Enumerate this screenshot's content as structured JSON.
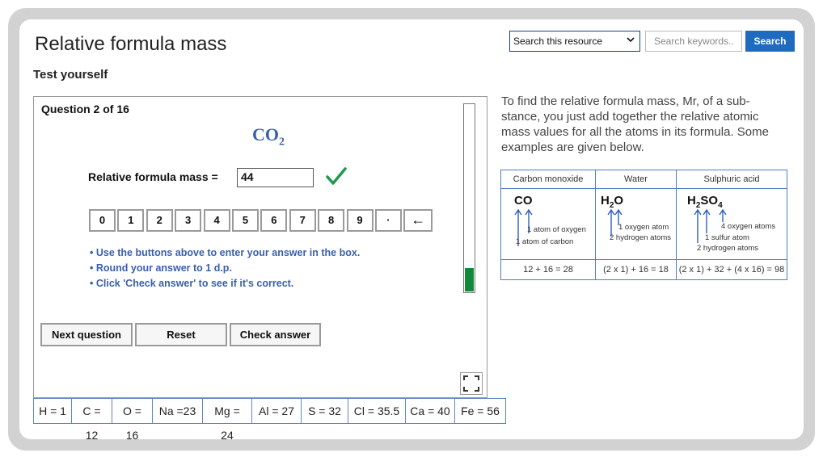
{
  "header": {
    "title": "Relative formula mass",
    "subtitle": "Test yourself",
    "search_select_value": "Search this resource",
    "search_placeholder": "Search keywords..",
    "search_button": "Search"
  },
  "quiz": {
    "question_count": "Question 2 of 16",
    "formula_main": "CO",
    "formula_sub": "2",
    "rfm_label": "Relative formula mass =",
    "answer_value": "44",
    "answer_status": "correct",
    "keypad": [
      "0",
      "1",
      "2",
      "3",
      "4",
      "5",
      "6",
      "7",
      "8",
      "9",
      "·",
      "←"
    ],
    "instructions": [
      "• Use the buttons above to enter your answer in the box.",
      "• Round your answer to 1 d.p.",
      "• Click 'Check answer' to see if it's correct."
    ],
    "progress_fraction": 0.125,
    "buttons": {
      "next": "Next question",
      "reset": "Reset",
      "check": "Check answer"
    }
  },
  "atomic_masses": [
    "H = 1",
    "C = 12",
    "O = 16",
    "Na =23",
    "Mg = 24",
    "Al = 27",
    "S = 32",
    "Cl = 35.5",
    "Ca = 40",
    "Fe = 56"
  ],
  "intro_text": "To find the relative formula mass, Mr, of a sub-stance, you just add together the relative atomic mass values for all the atoms in its formula. Some examples are given below.",
  "examples": {
    "carbon_monoxide": {
      "heading": "Carbon monoxide",
      "formula": "CO",
      "notes": [
        "1 atom of oxygen",
        "1 atom of carbon"
      ],
      "calc": "12 + 16 = 28"
    },
    "water": {
      "heading": "Water",
      "formula_a": "H",
      "formula_sub": "2",
      "formula_b": "O",
      "notes": [
        "1 oxygen atom",
        "2 hydrogen atoms"
      ],
      "calc": "(2 x 1) + 16 = 18"
    },
    "sulphuric_acid": {
      "heading": "Sulphuric acid",
      "formula_a": "H",
      "formula_sub1": "2",
      "formula_b": "SO",
      "formula_sub2": "4",
      "notes": [
        "4 oxygen atoms",
        "1 sulfur atom",
        "2 hydrogen atoms"
      ],
      "calc": "(2 x 1) + 32 + (4 x 16) = 98"
    }
  },
  "colors": {
    "accent": "#1f6bbf",
    "instruction_blue": "#3a5fae",
    "progress_green": "#14883a",
    "tick_green": "#1e9a4a",
    "arrow_blue": "#2d5fc0"
  }
}
